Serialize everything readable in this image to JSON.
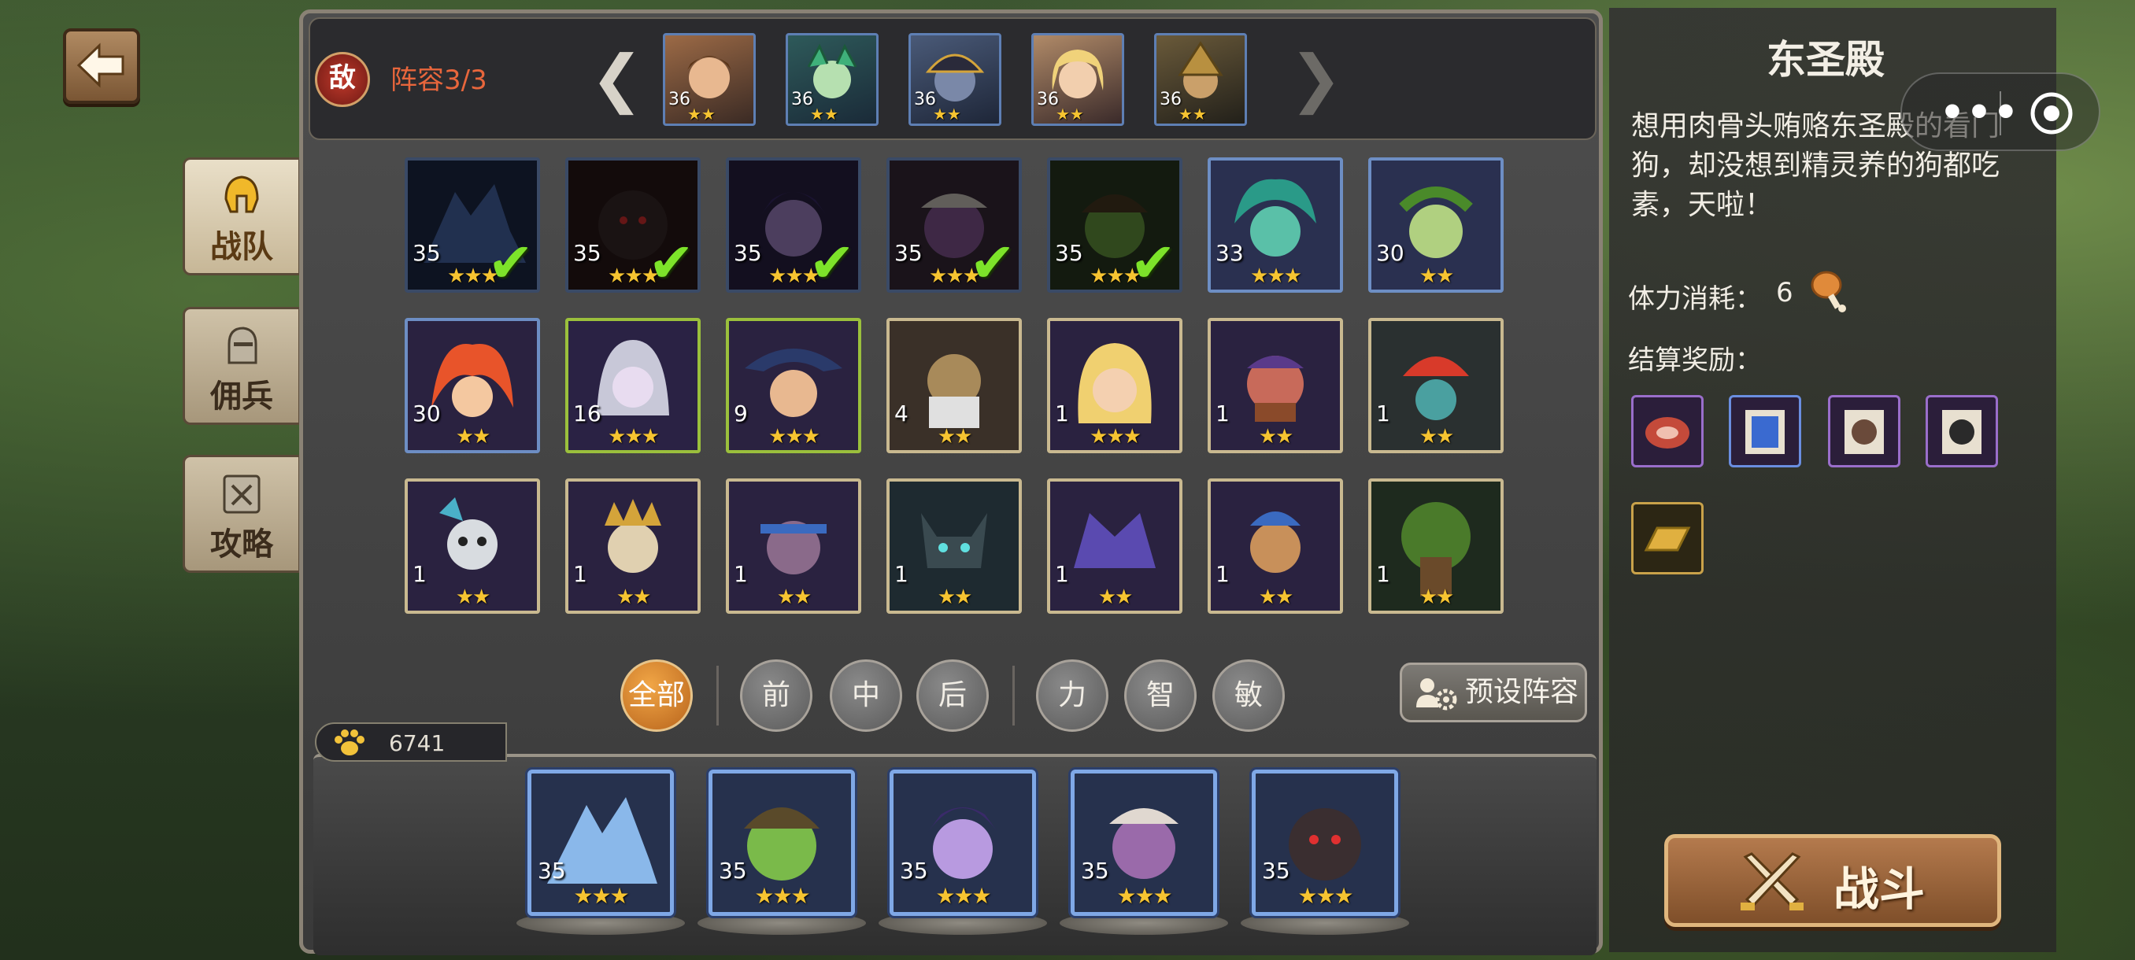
{
  "nav": {
    "back_icon": "arrow-left-icon"
  },
  "side_tabs": [
    {
      "label": "战队",
      "icon": "spartan-helmet-icon",
      "active": true
    },
    {
      "label": "佣兵",
      "icon": "knight-helmet-icon",
      "active": false
    },
    {
      "label": "攻略",
      "icon": "guide-book-icon",
      "active": false
    }
  ],
  "enemy": {
    "badge": "敌",
    "lineup": "阵容3/3",
    "heroes": [
      {
        "level": "36",
        "stars": "★★"
      },
      {
        "level": "36",
        "stars": "★★"
      },
      {
        "level": "36",
        "stars": "★★"
      },
      {
        "level": "36",
        "stars": "★★"
      },
      {
        "level": "36",
        "stars": "★★"
      }
    ]
  },
  "roster": [
    {
      "level": "35",
      "stars": "★★★",
      "selected": true
    },
    {
      "level": "35",
      "stars": "★★★",
      "selected": true
    },
    {
      "level": "35",
      "stars": "★★★",
      "selected": true
    },
    {
      "level": "35",
      "stars": "★★★",
      "selected": true
    },
    {
      "level": "35",
      "stars": "★★★",
      "selected": true
    },
    {
      "level": "33",
      "stars": "★★★",
      "selected": false
    },
    {
      "level": "30",
      "stars": "★★",
      "selected": false
    },
    {
      "level": "30",
      "stars": "★★",
      "selected": false
    },
    {
      "level": "16",
      "stars": "★★★",
      "selected": false
    },
    {
      "level": "9",
      "stars": "★★★",
      "selected": false
    },
    {
      "level": "4",
      "stars": "★★",
      "selected": false
    },
    {
      "level": "1",
      "stars": "★★★",
      "selected": false
    },
    {
      "level": "1",
      "stars": "★★",
      "selected": false
    },
    {
      "level": "1",
      "stars": "★★",
      "selected": false
    },
    {
      "level": "1",
      "stars": "★★",
      "selected": false
    },
    {
      "level": "1",
      "stars": "★★",
      "selected": false
    },
    {
      "level": "1",
      "stars": "★★",
      "selected": false
    },
    {
      "level": "1",
      "stars": "★★",
      "selected": false
    },
    {
      "level": "1",
      "stars": "★★",
      "selected": false
    },
    {
      "level": "1",
      "stars": "★★",
      "selected": false
    },
    {
      "level": "1",
      "stars": "★★",
      "selected": false
    }
  ],
  "filters": {
    "all": "全部",
    "position": [
      "前",
      "中",
      "后"
    ],
    "attribute": [
      "力",
      "智",
      "敏"
    ],
    "preset_label": "预设阵容",
    "preset_icon": "people-gear-icon"
  },
  "power": {
    "icon": "paw-icon",
    "value": "6741"
  },
  "team": [
    {
      "level": "35",
      "stars": "★★★"
    },
    {
      "level": "35",
      "stars": "★★★"
    },
    {
      "level": "35",
      "stars": "★★★"
    },
    {
      "level": "35",
      "stars": "★★★"
    },
    {
      "level": "35",
      "stars": "★★★"
    }
  ],
  "stage": {
    "title": "东圣殿",
    "description": "想用肉骨头贿赂东圣殿的看门狗，却没想到精灵养的狗都吃素，天啦！",
    "stamina_label": "体力消耗：",
    "stamina_value": "6",
    "stamina_icon": "meat-drumstick-icon",
    "rewards_label": "结算奖励：",
    "rewards": [
      "steak-icon",
      "blue-scroll-icon",
      "monster-scroll-icon",
      "dark-scroll-icon",
      "gold-bar-icon"
    ]
  },
  "fight": {
    "label": "战斗",
    "icon": "crossed-swords-icon"
  },
  "overlay": {
    "more": "•••",
    "target_icon": "target-icon"
  }
}
